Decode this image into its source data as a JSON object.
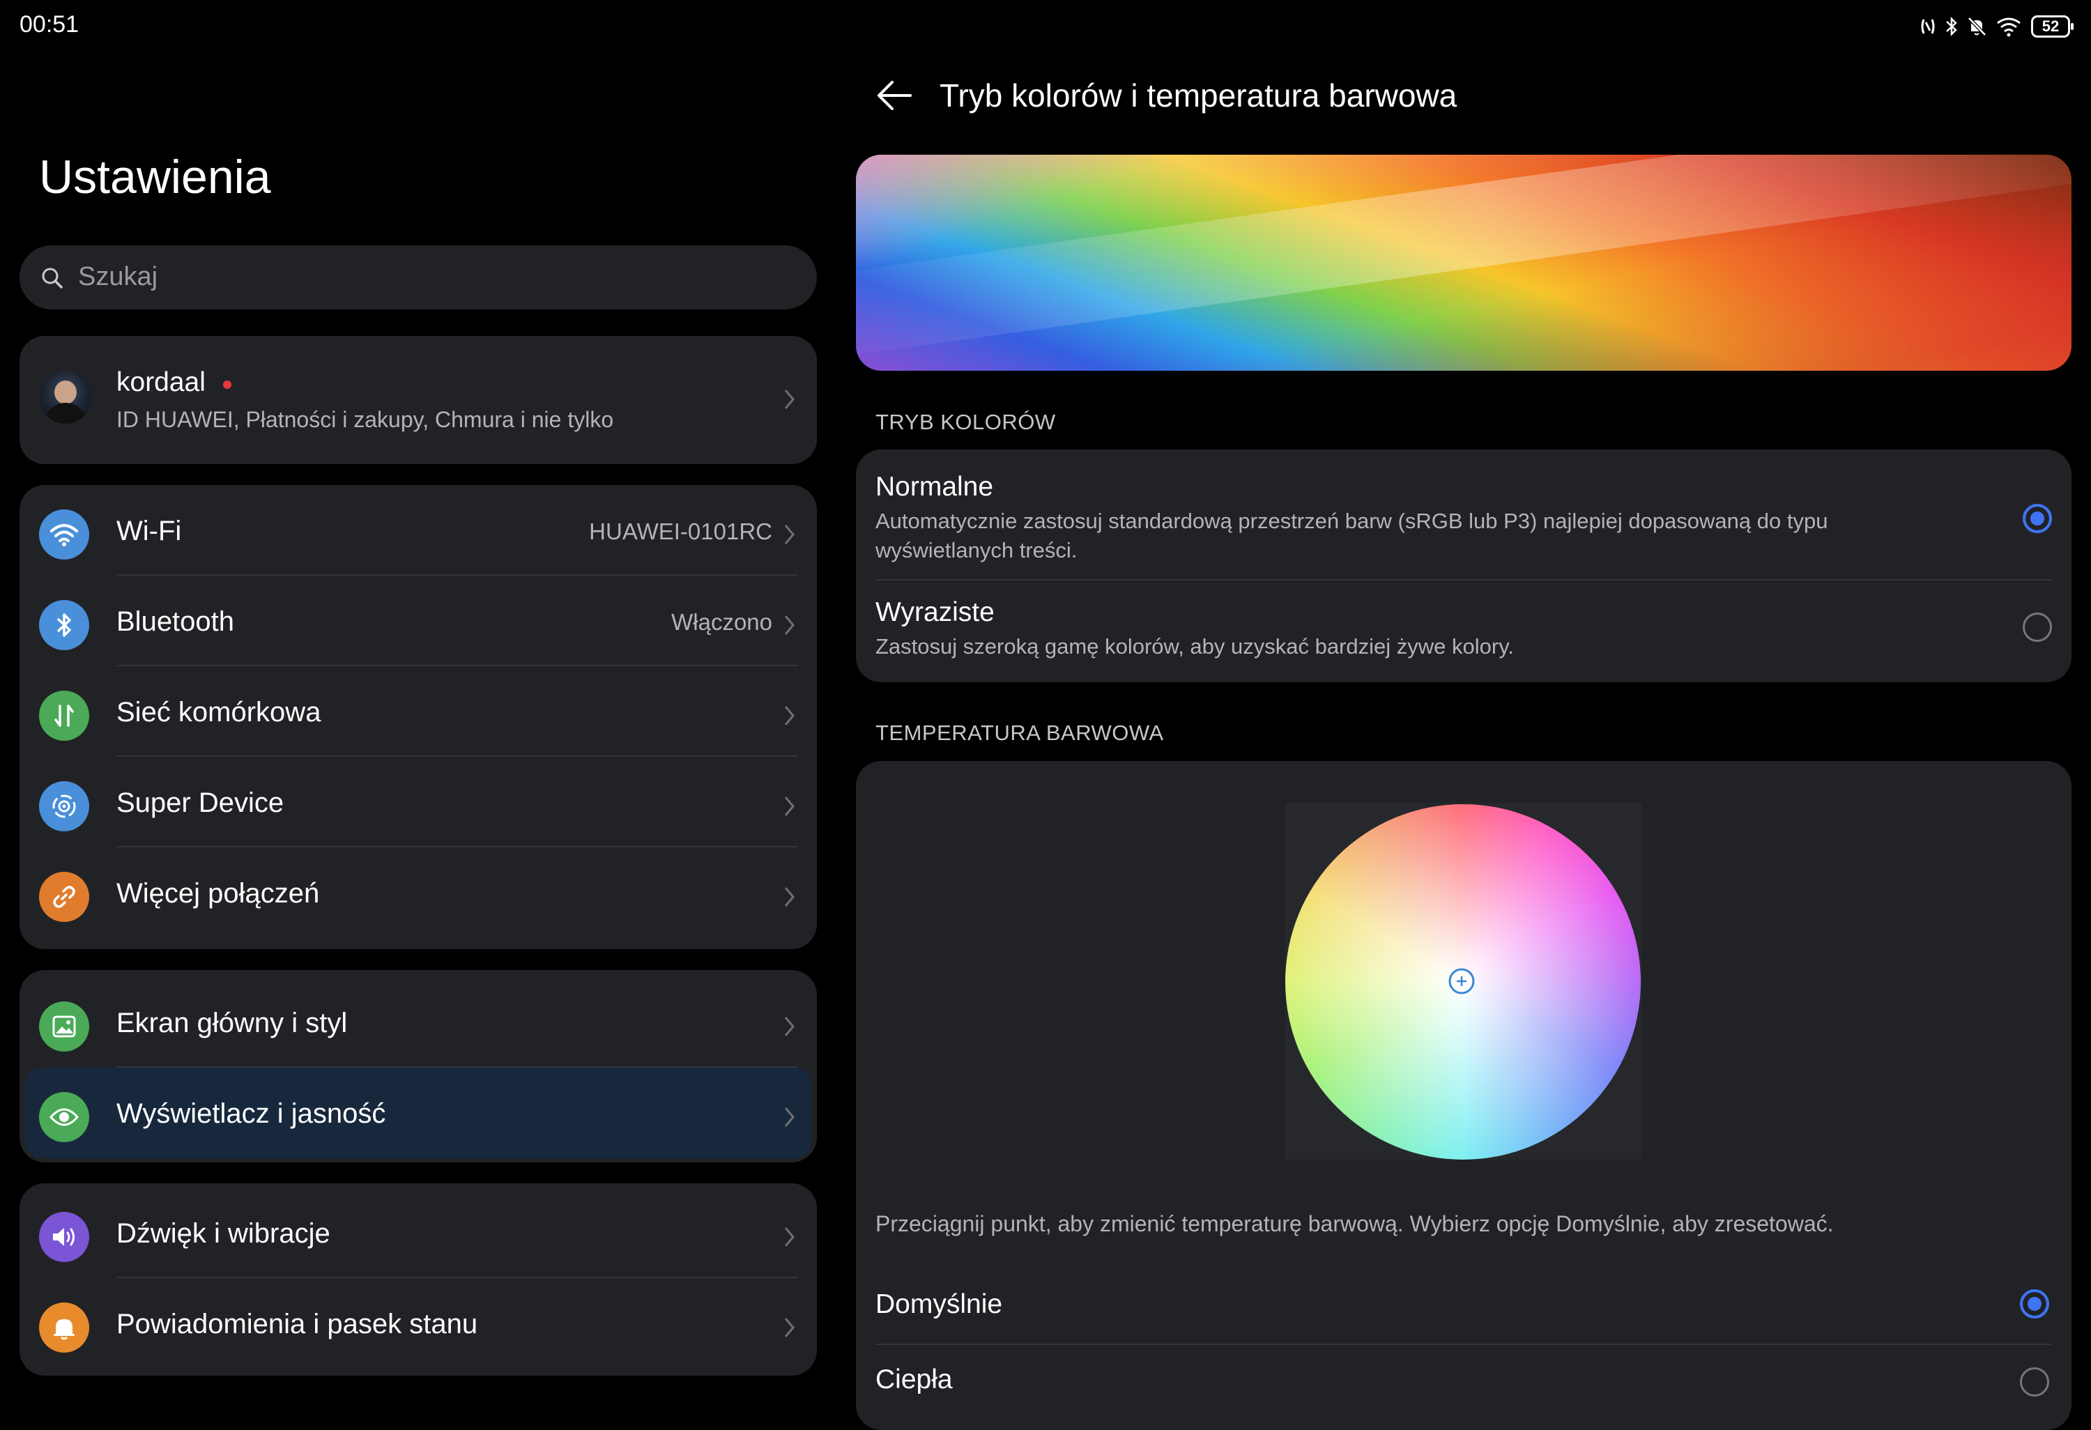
{
  "status_bar": {
    "time": "00:51",
    "battery": "52"
  },
  "left": {
    "title": "Ustawienia",
    "search_placeholder": "Szukaj",
    "account": {
      "name": "kordaal",
      "subtitle": "ID HUAWEI, Płatności i zakupy, Chmura i nie tylko"
    },
    "connectivity": [
      {
        "label": "Wi-Fi",
        "value": "HUAWEI-0101RC",
        "icon": "wifi-icon",
        "color": "#4a8fd9"
      },
      {
        "label": "Bluetooth",
        "value": "Włączono",
        "icon": "bluetooth-icon",
        "color": "#4a8fd9"
      },
      {
        "label": "Sieć komórkowa",
        "value": "",
        "icon": "mobile-network-icon",
        "color": "#4aaa57"
      },
      {
        "label": "Super Device",
        "value": "",
        "icon": "super-device-icon",
        "color": "#4a8fd9"
      },
      {
        "label": "Więcej połączeń",
        "value": "",
        "icon": "link-icon",
        "color": "#e07c2e"
      }
    ],
    "display_group": [
      {
        "label": "Ekran główny i styl",
        "icon": "image-icon",
        "color": "#4aaa57"
      },
      {
        "label": "Wyświetlacz i jasność",
        "icon": "eye-icon",
        "color": "#4aaa57"
      }
    ],
    "sound_group": [
      {
        "label": "Dźwięk i wibracje",
        "icon": "speaker-icon",
        "color": "#7a55d6"
      },
      {
        "label": "Powiadomienia i pasek stanu",
        "icon": "bell-icon",
        "color": "#e88b2c"
      }
    ]
  },
  "right": {
    "title": "Tryb kolorów i temperatura barwowa",
    "color_mode": {
      "heading": "TRYB KOLORÓW",
      "options": [
        {
          "title": "Normalne",
          "desc": "Automatycznie zastosuj standardową przestrzeń barw (sRGB lub P3) najlepiej dopasowaną do typu wyświetlanych treści.",
          "selected": true
        },
        {
          "title": "Wyraziste",
          "desc": "Zastosuj szeroką gamę kolorów, aby uzyskać bardziej żywe kolory.",
          "selected": false
        }
      ]
    },
    "temperature": {
      "heading": "TEMPERATURA BARWOWA",
      "hint": "Przeciągnij punkt, aby zmienić temperaturę barwową. Wybierz opcję Domyślnie, aby zresetować.",
      "options": [
        {
          "title": "Domyślnie",
          "selected": true
        },
        {
          "title": "Ciepła",
          "selected": false
        }
      ]
    }
  },
  "colors": {
    "accent": "#3f74f2",
    "card": "#212226",
    "active_row": "#17283c"
  }
}
